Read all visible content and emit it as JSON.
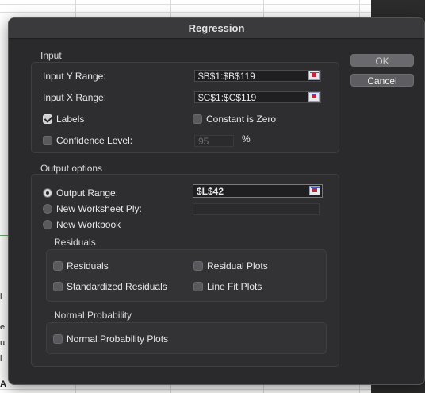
{
  "dialog": {
    "title": "Regression",
    "ok_label": "OK",
    "cancel_label": "Cancel"
  },
  "input": {
    "section_label": "Input",
    "y_range_label": "Input Y Range:",
    "y_range_value": "$B$1:$B$119",
    "x_range_label": "Input X Range:",
    "x_range_value": "$C$1:$C$119",
    "labels_label": "Labels",
    "labels_checked": true,
    "constant_zero_label": "Constant is Zero",
    "constant_zero_checked": false,
    "confidence_label": "Confidence Level:",
    "confidence_checked": false,
    "confidence_value": "95",
    "confidence_unit": "%"
  },
  "output": {
    "section_label": "Output options",
    "output_range_label": "Output Range:",
    "output_range_value": "$L$42",
    "new_ply_label": "New Worksheet Ply:",
    "new_ply_value": "",
    "new_workbook_label": "New Workbook",
    "selected": "output_range",
    "residuals": {
      "group_label": "Residuals",
      "residuals_label": "Residuals",
      "residual_plots_label": "Residual Plots",
      "standardized_label": "Standardized Residuals",
      "line_fit_label": "Line Fit Plots"
    },
    "normal_probability": {
      "group_label": "Normal Probability",
      "plots_label": "Normal Probability Plots"
    }
  },
  "sheet_edge_letters": [
    "l",
    "e",
    "u",
    "i",
    "A"
  ],
  "colors": {
    "dialog_bg": "#2a2a2c",
    "group_bg": "#2e2e31",
    "button_bg": "#5e5e62"
  }
}
